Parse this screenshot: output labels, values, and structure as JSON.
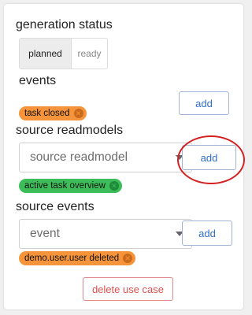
{
  "generation_status": {
    "label": "generation status",
    "options": [
      "planned",
      "ready"
    ],
    "selected": "planned"
  },
  "events": {
    "label": "events",
    "add_label": "add",
    "chips": [
      {
        "label": "task closed",
        "color": "#f6943b"
      }
    ]
  },
  "source_readmodels": {
    "label": "source readmodels",
    "select_placeholder": "source readmodel",
    "add_label": "add",
    "chips": [
      {
        "label": "active task overview",
        "color": "#3dbd5a"
      }
    ]
  },
  "source_events": {
    "label": "source events",
    "select_placeholder": "event",
    "add_label": "add",
    "chips": [
      {
        "label": "demo.user.user deleted",
        "color": "#f6943b"
      }
    ]
  },
  "actions": {
    "delete_label": "delete use case"
  },
  "icons": {
    "chip_remove": "close-circle-icon",
    "select_caret": "caret-down-icon"
  },
  "colors": {
    "accent": "#2f6fcf",
    "danger": "#d9534f",
    "highlight": "#d42020"
  }
}
